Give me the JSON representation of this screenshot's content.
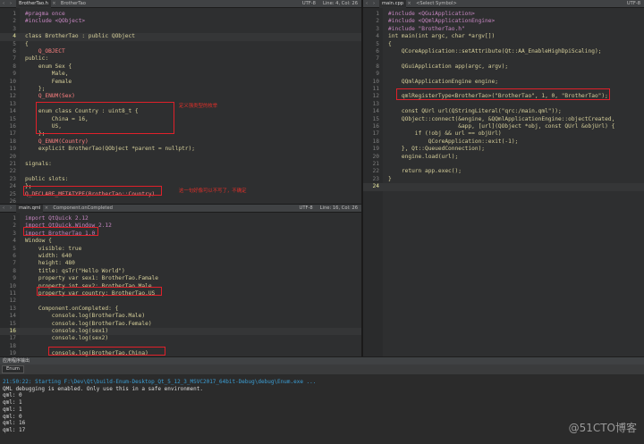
{
  "header_pane": {
    "file_tab": "BrotherTao.h",
    "symbol": "BrotherTao",
    "encoding": "UTF-8",
    "position": "Line: 4, Col: 26",
    "lines": [
      {
        "n": "1",
        "t": "#pragma once",
        "c": "#c586c0"
      },
      {
        "n": "2",
        "t": "#include <QObject>",
        "c": "#c586c0"
      },
      {
        "n": "3",
        "t": "",
        "c": "#d6cf9a"
      },
      {
        "n": "4",
        "t": "class BrotherTao : public QObject",
        "c": "#d6cf9a"
      },
      {
        "n": "5",
        "t": "{",
        "c": "#d6cf9a"
      },
      {
        "n": "6",
        "t": "    Q_OBJECT",
        "c": "#ff8080"
      },
      {
        "n": "7",
        "t": "public:",
        "c": "#d6cf9a"
      },
      {
        "n": "8",
        "t": "    enum Sex {",
        "c": "#d6cf9a"
      },
      {
        "n": "9",
        "t": "        Male,",
        "c": "#d6cf9a"
      },
      {
        "n": "10",
        "t": "        Female",
        "c": "#d6cf9a"
      },
      {
        "n": "11",
        "t": "    };",
        "c": "#d6cf9a"
      },
      {
        "n": "12",
        "t": "    Q_ENUM(Sex)",
        "c": "#ff8080"
      },
      {
        "n": "13",
        "t": "",
        "c": "#d6cf9a"
      },
      {
        "n": "14",
        "t": "    enum class Country : uint8_t {",
        "c": "#d6cf9a"
      },
      {
        "n": "15",
        "t": "        China = 16,",
        "c": "#d6cf9a"
      },
      {
        "n": "16",
        "t": "        US,",
        "c": "#d6cf9a"
      },
      {
        "n": "17",
        "t": "    };",
        "c": "#d6cf9a"
      },
      {
        "n": "18",
        "t": "    Q_ENUM(Country)",
        "c": "#ff8080"
      },
      {
        "n": "19",
        "t": "    explicit BrotherTao(QObject *parent = nullptr);",
        "c": "#d6cf9a"
      },
      {
        "n": "20",
        "t": "",
        "c": "#d6cf9a"
      },
      {
        "n": "21",
        "t": "signals:",
        "c": "#d6cf9a"
      },
      {
        "n": "22",
        "t": "",
        "c": "#d6cf9a"
      },
      {
        "n": "23",
        "t": "public slots:",
        "c": "#d6cf9a"
      },
      {
        "n": "24",
        "t": "};",
        "c": "#d6cf9a"
      },
      {
        "n": "25",
        "t": "Q_DECLARE_METATYPE(BrotherTao::Country)",
        "c": "#ff8080"
      },
      {
        "n": "26",
        "t": "",
        "c": "#d6cf9a"
      }
    ],
    "annotation_1": "定义强类型的枚举",
    "annotation_2": "这一句好像可以不写了，不确定"
  },
  "qml_pane": {
    "file_tab": "main.qml",
    "symbol": "Component.onCompleted",
    "encoding": "UTF-8",
    "position": "Line: 16, Col: 26",
    "lines": [
      {
        "n": "1",
        "t": "import QtQuick 2.12",
        "c": "#c586c0"
      },
      {
        "n": "2",
        "t": "import QtQuick.Window 2.12",
        "c": "#c586c0"
      },
      {
        "n": "3",
        "t": "import BrotherTao 1.0",
        "c": "#c586c0"
      },
      {
        "n": "4",
        "t": "Window {",
        "c": "#d6cf9a"
      },
      {
        "n": "5",
        "t": "    visible: true",
        "c": "#d6cf9a"
      },
      {
        "n": "6",
        "t": "    width: 640",
        "c": "#d6cf9a"
      },
      {
        "n": "7",
        "t": "    height: 480",
        "c": "#d6cf9a"
      },
      {
        "n": "8",
        "t": "    title: qsTr(\"Hello World\")",
        "c": "#d6cf9a"
      },
      {
        "n": "9",
        "t": "    property var sex1: BrotherTao.Famale",
        "c": "#d6cf9a"
      },
      {
        "n": "10",
        "t": "    property int sex2: BrotherTao.Male",
        "c": "#d6cf9a"
      },
      {
        "n": "11",
        "t": "    property var country: BrotherTao.US",
        "c": "#d6cf9a"
      },
      {
        "n": "12",
        "t": "",
        "c": "#d6cf9a"
      },
      {
        "n": "13",
        "t": "    Component.onCompleted: {",
        "c": "#d6cf9a"
      },
      {
        "n": "14",
        "t": "        console.log(BrotherTao.Male)",
        "c": "#d6cf9a"
      },
      {
        "n": "15",
        "t": "        console.log(BrotherTao.Female)",
        "c": "#d6cf9a"
      },
      {
        "n": "16",
        "t": "        console.log(sex1)",
        "c": "#d6cf9a"
      },
      {
        "n": "17",
        "t": "        console.log(sex2)",
        "c": "#d6cf9a"
      },
      {
        "n": "18",
        "t": "",
        "c": "#d6cf9a"
      },
      {
        "n": "19",
        "t": "        console.log(BrotherTao.China)",
        "c": "#d6cf9a"
      }
    ]
  },
  "cpp_pane": {
    "file_tab": "main.cpp",
    "symbol": "<Select Symbol>",
    "encoding": "UTF-8",
    "lines": [
      {
        "n": "1",
        "t": "#include <QGuiApplication>",
        "c": "#c586c0"
      },
      {
        "n": "2",
        "t": "#include <QQmlApplicationEngine>",
        "c": "#c586c0"
      },
      {
        "n": "3",
        "t": "#include \"BrotherTao.h\"",
        "c": "#c586c0"
      },
      {
        "n": "4",
        "t": "int main(int argc, char *argv[])",
        "c": "#d6cf9a"
      },
      {
        "n": "5",
        "t": "{",
        "c": "#d6cf9a"
      },
      {
        "n": "6",
        "t": "    QCoreApplication::setAttribute(Qt::AA_EnableHighDpiScaling);",
        "c": "#d6cf9a"
      },
      {
        "n": "7",
        "t": "",
        "c": "#d6cf9a"
      },
      {
        "n": "8",
        "t": "    QGuiApplication app(argc, argv);",
        "c": "#d6cf9a"
      },
      {
        "n": "9",
        "t": "",
        "c": "#d6cf9a"
      },
      {
        "n": "10",
        "t": "    QQmlApplicationEngine engine;",
        "c": "#d6cf9a"
      },
      {
        "n": "11",
        "t": "",
        "c": "#d6cf9a"
      },
      {
        "n": "12",
        "t": "    qmlRegisterType<BrotherTao>(\"BrotherTao\", 1, 0, \"BrotherTao\");",
        "c": "#d6cf9a"
      },
      {
        "n": "13",
        "t": "",
        "c": "#d6cf9a"
      },
      {
        "n": "14",
        "t": "    const QUrl url(QStringLiteral(\"qrc:/main.qml\"));",
        "c": "#d6cf9a"
      },
      {
        "n": "15",
        "t": "    QObject::connect(&engine, &QQmlApplicationEngine::objectCreated,",
        "c": "#d6cf9a"
      },
      {
        "n": "16",
        "t": "                     &app, [url](QObject *obj, const QUrl &objUrl) {",
        "c": "#d6cf9a"
      },
      {
        "n": "17",
        "t": "        if (!obj && url == objUrl)",
        "c": "#d6cf9a"
      },
      {
        "n": "18",
        "t": "            QCoreApplication::exit(-1);",
        "c": "#d6cf9a"
      },
      {
        "n": "19",
        "t": "    }, Qt::QueuedConnection);",
        "c": "#d6cf9a"
      },
      {
        "n": "20",
        "t": "    engine.load(url);",
        "c": "#d6cf9a"
      },
      {
        "n": "21",
        "t": "",
        "c": "#d6cf9a"
      },
      {
        "n": "22",
        "t": "    return app.exec();",
        "c": "#d6cf9a"
      },
      {
        "n": "23",
        "t": "}",
        "c": "#d6cf9a"
      },
      {
        "n": "24",
        "t": "",
        "c": "#d6cf9a"
      }
    ]
  },
  "output_panel": {
    "header": "应用程序输出",
    "tab_label": "Enum",
    "lines": [
      "21:50:22: Starting F:\\Dev\\Qt\\build-Enum-Desktop_Qt_5_12_3_MSVC2017_64bit-Debug\\debug\\Enum.exe ...",
      "QML debugging is enabled. Only use this in a safe environment.",
      "qml: 0",
      "qml: 1",
      "qml: 1",
      "qml: 0",
      "qml: 16",
      "qml: 17"
    ]
  },
  "watermark": "@51CTO博客"
}
